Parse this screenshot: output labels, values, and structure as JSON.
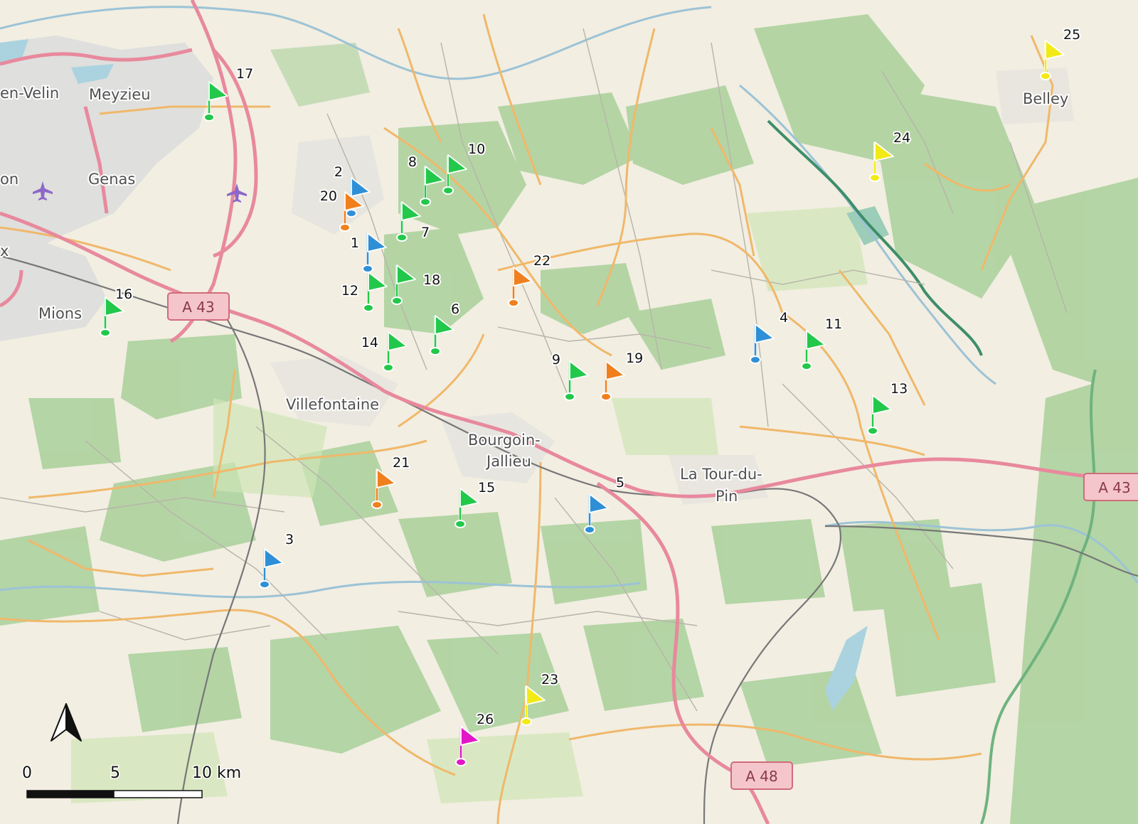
{
  "places": {
    "meyzieu": "Meyzieu",
    "vaulx": "en-Velin",
    "genas": "Genas",
    "lyon": "on",
    "x": "x",
    "mions": "Mions",
    "villefontaine": "Villefontaine",
    "bourgoin_1": "Bourgoin-",
    "bourgoin_2": "Jallieu",
    "latour_1": "La Tour-du-",
    "latour_2": "Pin",
    "belley": "Belley"
  },
  "roads": {
    "a43_west": "A 43",
    "a43_east": "A 43",
    "a48": "A 48"
  },
  "flag_colors": {
    "green": "#22c84a",
    "blue": "#2f8fd6",
    "orange": "#f07f1d",
    "yellow": "#f2ea16",
    "magenta": "#e216c6"
  },
  "flags": [
    {
      "label": "1",
      "color": "blue"
    },
    {
      "label": "2",
      "color": "blue"
    },
    {
      "label": "3",
      "color": "blue"
    },
    {
      "label": "4",
      "color": "blue"
    },
    {
      "label": "5",
      "color": "blue"
    },
    {
      "label": "6",
      "color": "green"
    },
    {
      "label": "7",
      "color": "green"
    },
    {
      "label": "8",
      "color": "green"
    },
    {
      "label": "9",
      "color": "green"
    },
    {
      "label": "10",
      "color": "green"
    },
    {
      "label": "11",
      "color": "green"
    },
    {
      "label": "12",
      "color": "green"
    },
    {
      "label": "13",
      "color": "green"
    },
    {
      "label": "14",
      "color": "green"
    },
    {
      "label": "15",
      "color": "green"
    },
    {
      "label": "16",
      "color": "green"
    },
    {
      "label": "17",
      "color": "green"
    },
    {
      "label": "18",
      "color": "green"
    },
    {
      "label": "19",
      "color": "orange"
    },
    {
      "label": "20",
      "color": "orange"
    },
    {
      "label": "21",
      "color": "orange"
    },
    {
      "label": "22",
      "color": "orange"
    },
    {
      "label": "23",
      "color": "yellow"
    },
    {
      "label": "24",
      "color": "yellow"
    },
    {
      "label": "25",
      "color": "yellow"
    },
    {
      "label": "26",
      "color": "magenta"
    }
  ],
  "scale_bar": {
    "tick_0": "0",
    "tick_5": "5",
    "tick_10": "10 km"
  },
  "north_arrow": "north-arrow-icon"
}
